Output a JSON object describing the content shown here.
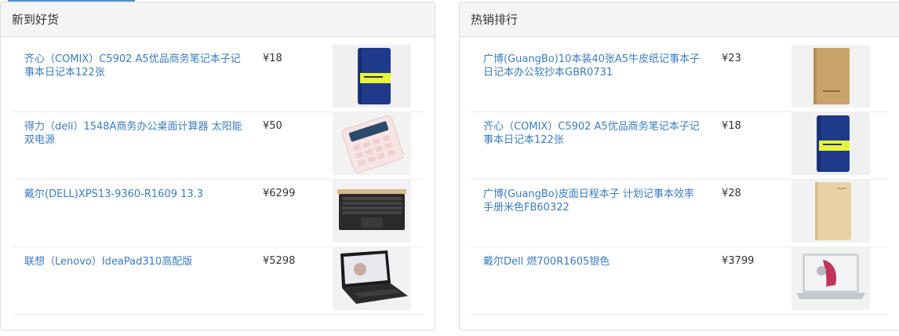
{
  "new_goods": {
    "title": "新到好货",
    "items": [
      {
        "name": "齐心（COMIX）C5902 A5优品商务笔记本子记事本日记本122张",
        "price": "¥18",
        "image": "blue-notebook-image"
      },
      {
        "name": "得力（deli）1548A商务办公桌面计算器 太阳能双电源",
        "price": "¥50",
        "image": "pink-calculator-image"
      },
      {
        "name": "戴尔(DELL)XPS13-9360-R1609 13.3",
        "price": "¥6299",
        "image": "dell-xps-laptop-image"
      },
      {
        "name": "联想（Lenovo）IdeaPad310高配版",
        "price": "¥5298",
        "image": "lenovo-laptop-image"
      }
    ]
  },
  "hot_ranking": {
    "title": "热销排行",
    "items": [
      {
        "name": "广博(GuangBo)10本装40张A5牛皮纸记事本子日记本办公软抄本GBR0731",
        "price": "¥23",
        "image": "kraft-notebook-image"
      },
      {
        "name": "齐心（COMIX）C5902 A5优品商务笔记本子记事本日记本122张",
        "price": "¥18",
        "image": "blue-notebook-image"
      },
      {
        "name": "广博(GuangBo)皮面日程本子 计划记事本效率手册米色FB60322",
        "price": "¥28",
        "image": "beige-planner-image"
      },
      {
        "name": "戴尔Dell 燃700R1605银色",
        "price": "¥3799",
        "image": "dell-silver-laptop-image"
      }
    ]
  }
}
